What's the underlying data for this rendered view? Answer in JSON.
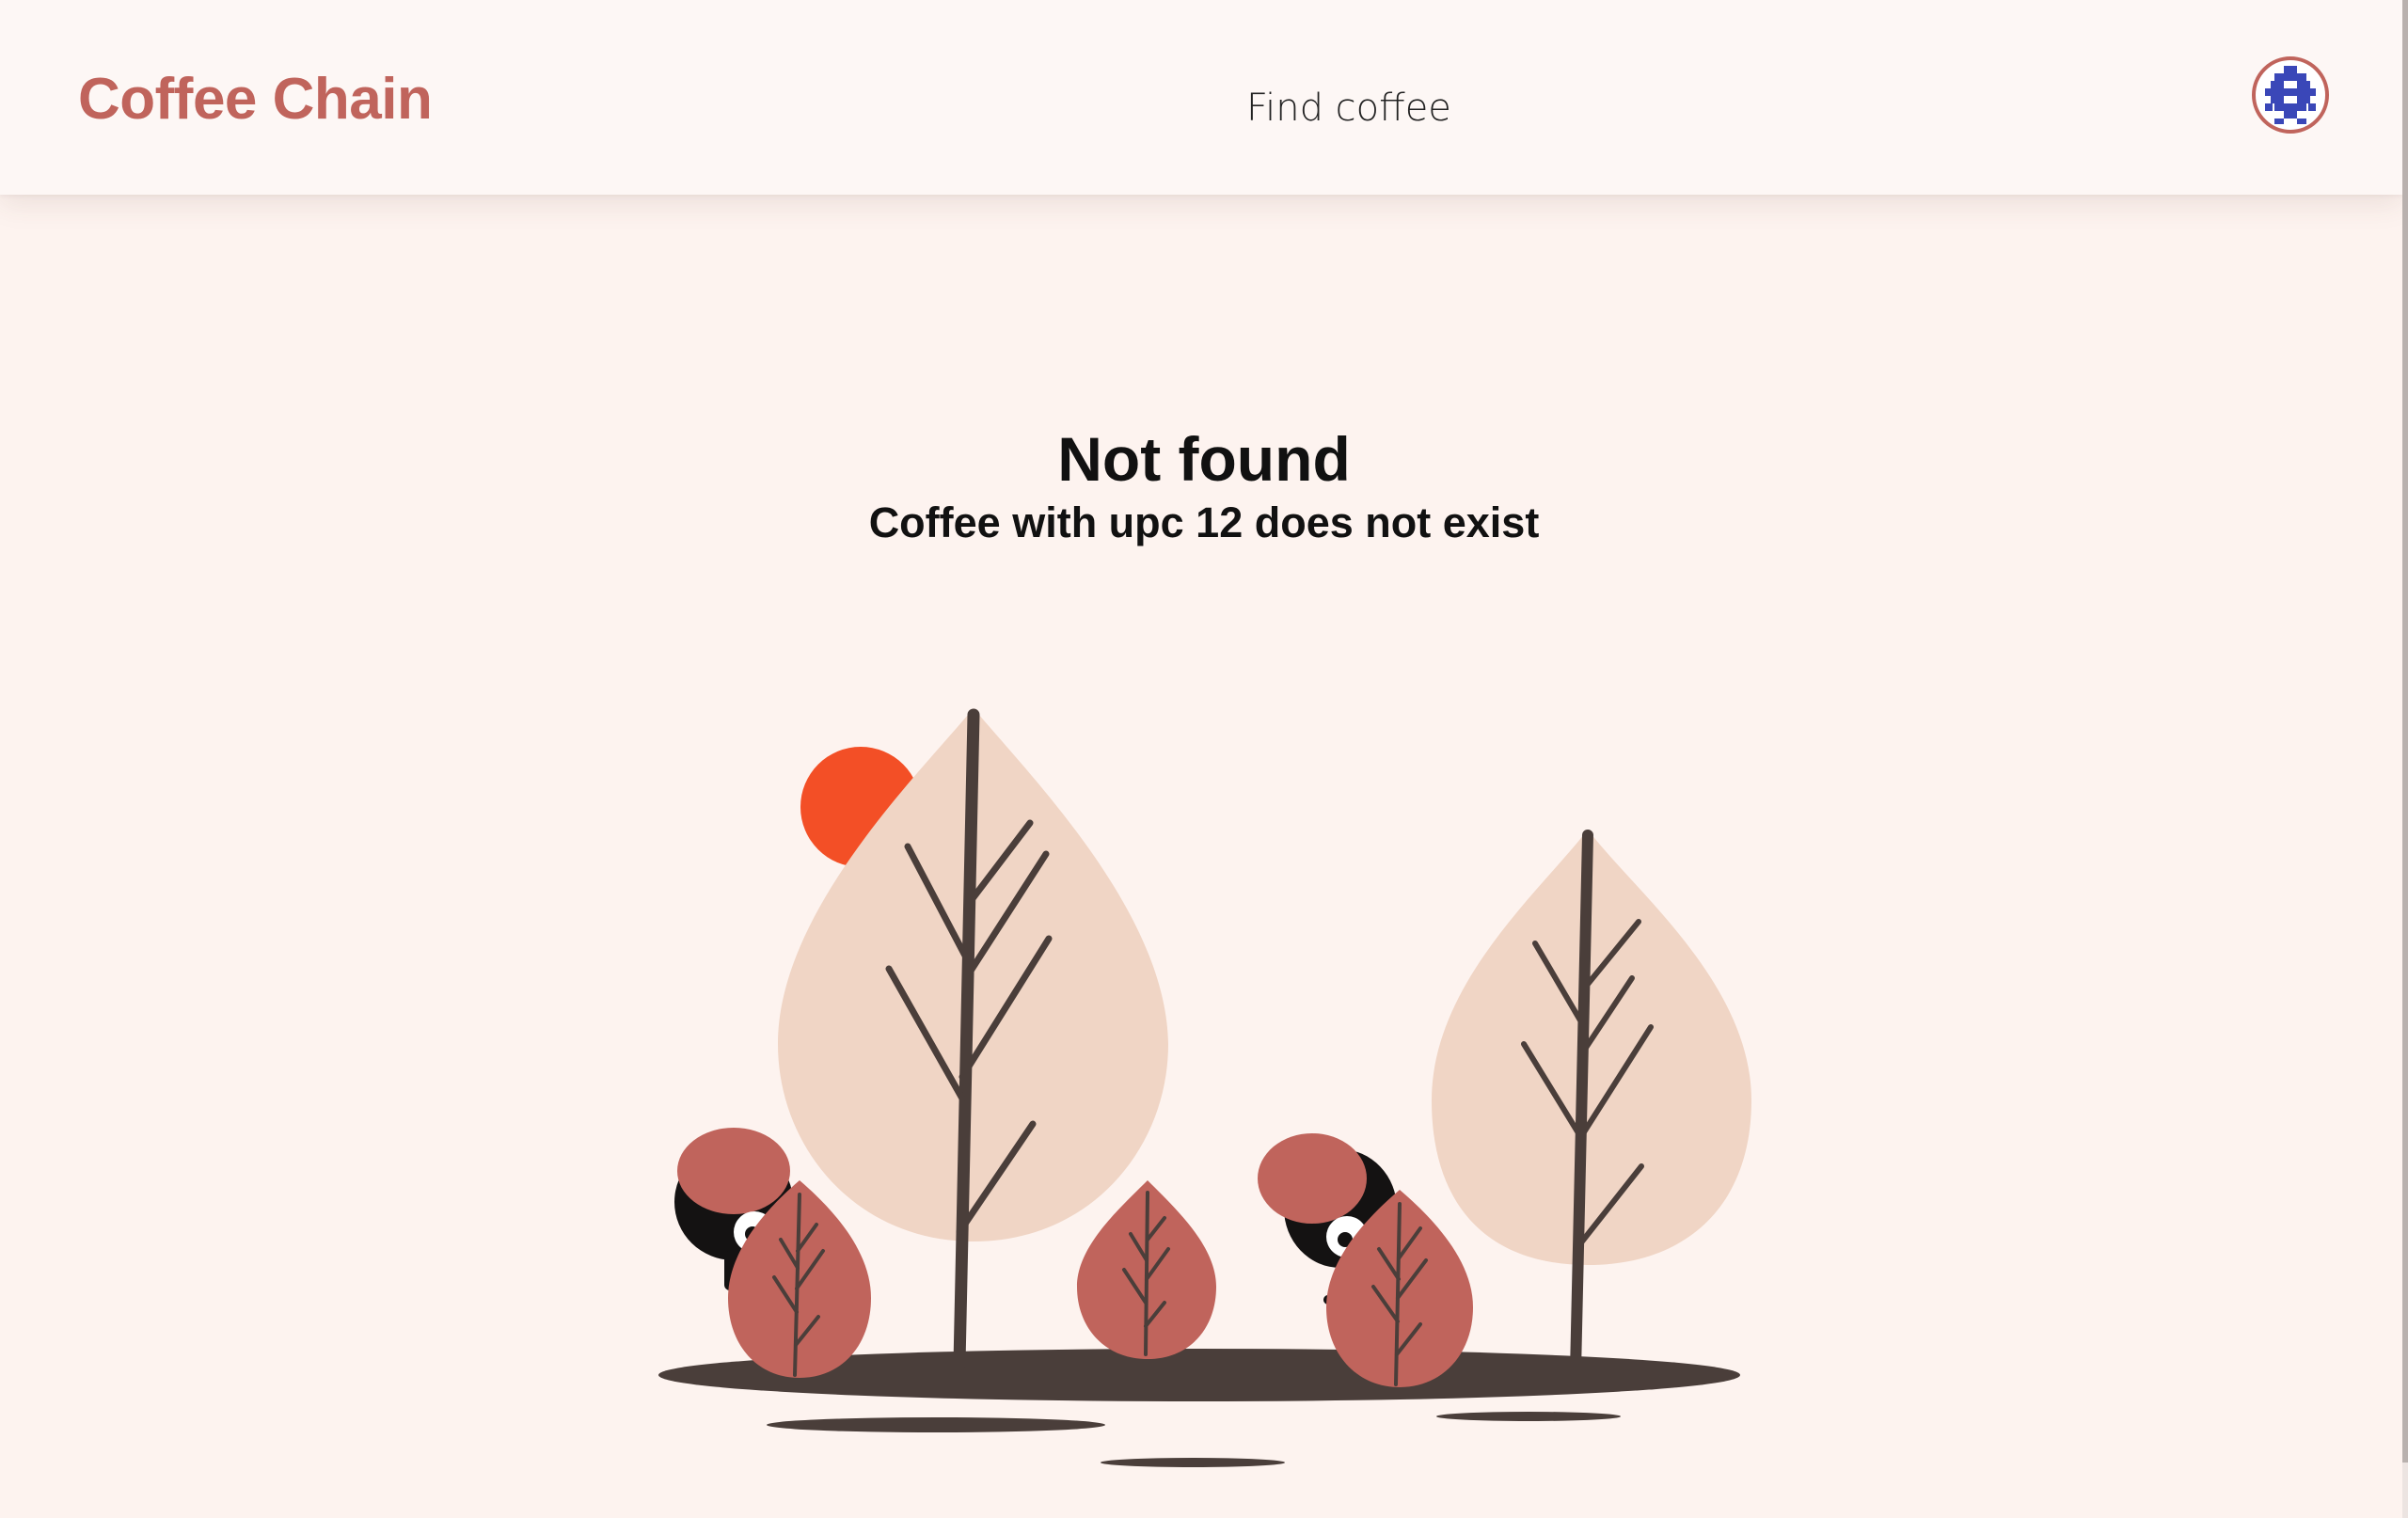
{
  "header": {
    "brand": "Coffee Chain",
    "nav": {
      "find_coffee_label": "Find coffee"
    },
    "avatar_icon": "identicon-avatar-icon"
  },
  "main": {
    "title": "Not found",
    "message": "Coffee with upc 12 does not exist",
    "illustration_icon": "not-found-forest-illustration"
  },
  "colors": {
    "brand": "#c0645c",
    "background": "#fdf3ef",
    "header_bg": "#fdf7f5",
    "tree_light": "#f0d5c5",
    "leaf": "#c0645c",
    "ground": "#4a3e3a",
    "sun": "#f34f26",
    "avatar_blue": "#3a47b8"
  }
}
